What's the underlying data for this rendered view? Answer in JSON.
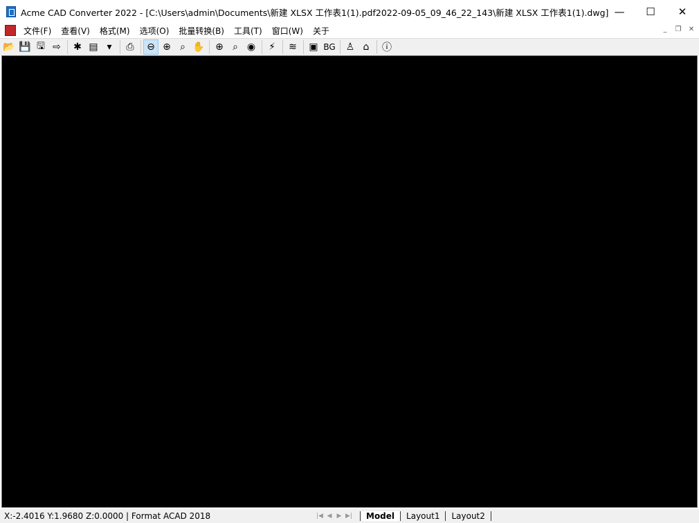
{
  "window": {
    "title": "Acme CAD Converter 2022 - [C:\\Users\\admin\\Documents\\新建 XLSX 工作表1(1).pdf2022-09-05_09_46_22_143\\新建 XLSX 工作表1(1).dwg]",
    "minimize": "—",
    "maximize": "☐",
    "close": "✕"
  },
  "menu": {
    "items": [
      "文件(F)",
      "查看(V)",
      "格式(M)",
      "选项(O)",
      "批量转换(B)",
      "工具(T)",
      "窗口(W)",
      "关于"
    ],
    "mdi": {
      "minimize": "_",
      "restore": "❐",
      "close": "✕"
    }
  },
  "toolbar": {
    "groups": [
      [
        {
          "icon": "open-folder-icon",
          "glyph": "📂"
        },
        {
          "icon": "save-icon",
          "glyph": "💾"
        },
        {
          "icon": "save-as-icon",
          "glyph": "🖫"
        },
        {
          "icon": "export-icon",
          "glyph": "⇨"
        }
      ],
      [
        {
          "icon": "convert-pdf-icon",
          "glyph": "✱"
        },
        {
          "icon": "batch-convert-icon",
          "glyph": "▤"
        },
        {
          "icon": "dropdown-icon",
          "glyph": "▾"
        }
      ],
      [
        {
          "icon": "print-icon",
          "glyph": "⎙"
        }
      ],
      [
        {
          "icon": "zoom-out-icon",
          "glyph": "⊖",
          "active": true
        },
        {
          "icon": "zoom-in-icon",
          "glyph": "⊕"
        },
        {
          "icon": "zoom-window-icon",
          "glyph": "⌕"
        },
        {
          "icon": "pan-icon",
          "glyph": "✋"
        }
      ],
      [
        {
          "icon": "zoom-extents-icon",
          "glyph": "⊕"
        },
        {
          "icon": "zoom-realtime-icon",
          "glyph": "⌕"
        },
        {
          "icon": "view-3d-icon",
          "glyph": "◉"
        }
      ],
      [
        {
          "icon": "measure-icon",
          "glyph": "⚡"
        }
      ],
      [
        {
          "icon": "layers-icon",
          "glyph": "≋"
        }
      ],
      [
        {
          "icon": "frame-icon",
          "glyph": "▣"
        },
        {
          "icon": "background-icon",
          "glyph": "BG"
        }
      ],
      [
        {
          "icon": "user-icon",
          "glyph": "♙"
        },
        {
          "icon": "home-icon",
          "glyph": "⌂"
        }
      ],
      [
        {
          "icon": "info-icon",
          "glyph": "ⓘ"
        }
      ]
    ]
  },
  "status": {
    "coords": "X:-2.4016 Y:1.9680 Z:0.0000 | Format ACAD 2018",
    "nav": [
      "|◀",
      "◀",
      "▶",
      "▶|"
    ],
    "tabs": [
      "Model",
      "Layout1",
      "Layout2"
    ],
    "active_tab": "Model"
  },
  "colors": {
    "canvas": "#000000",
    "accent": "#1e6fc8"
  }
}
